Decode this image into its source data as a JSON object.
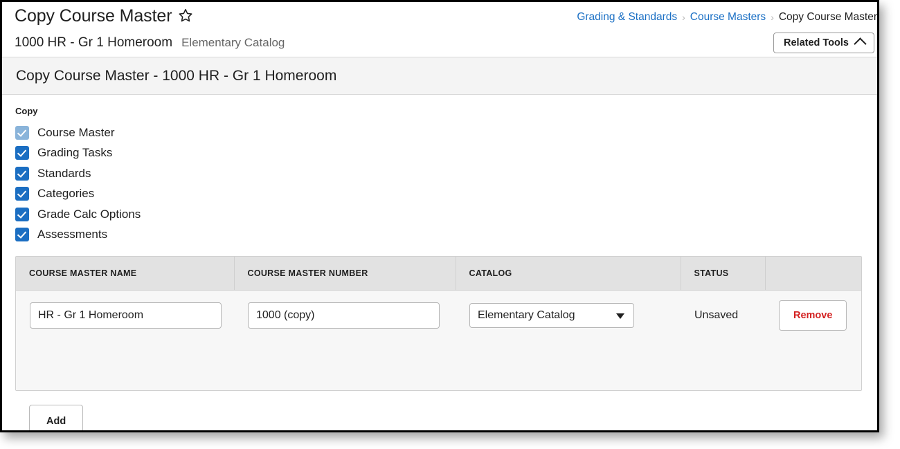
{
  "header": {
    "title": "Copy Course Master",
    "favorite_icon": "star-icon",
    "subtitle_main": "1000 HR - Gr 1 Homeroom",
    "subtitle_secondary": "Elementary Catalog",
    "breadcrumb": {
      "separator": "›",
      "items": [
        {
          "label": "Grading & Standards",
          "is_link": true
        },
        {
          "label": "Course Masters",
          "is_link": true
        },
        {
          "label": "Copy Course Master",
          "is_link": false
        }
      ]
    },
    "related_tools": {
      "label": "Related Tools",
      "icon": "chevron-up-icon"
    }
  },
  "section": {
    "title": "Copy Course Master - 1000 HR - Gr 1 Homeroom"
  },
  "copy_options": {
    "group_label": "Copy",
    "items": [
      {
        "label": "Course Master",
        "checked": true,
        "disabled": true
      },
      {
        "label": "Grading Tasks",
        "checked": true,
        "disabled": false
      },
      {
        "label": "Standards",
        "checked": true,
        "disabled": false
      },
      {
        "label": "Categories",
        "checked": true,
        "disabled": false
      },
      {
        "label": "Grade Calc Options",
        "checked": true,
        "disabled": false
      },
      {
        "label": "Assessments",
        "checked": true,
        "disabled": false
      }
    ]
  },
  "table": {
    "columns": [
      "COURSE MASTER NAME",
      "COURSE MASTER NUMBER",
      "CATALOG",
      "STATUS",
      ""
    ],
    "rows": [
      {
        "course_master_name": "HR - Gr 1 Homeroom",
        "course_master_name_placeholder": "",
        "course_master_number": "1000 (copy)",
        "course_master_number_placeholder": "",
        "catalog": "Elementary Catalog",
        "catalog_options": [
          "Elementary Catalog"
        ],
        "status": "Unsaved",
        "remove_label": "Remove"
      }
    ]
  },
  "actions": {
    "add_label": "Add"
  },
  "colors": {
    "link": "#1a6fc4",
    "checkbox_active": "#1b6ec2",
    "checkbox_disabled": "#8ab4da",
    "remove_text": "#d32121",
    "band_background": "#f4f4f4",
    "table_header_background": "#e2e2e2",
    "table_row_background": "#f7f7f7"
  }
}
